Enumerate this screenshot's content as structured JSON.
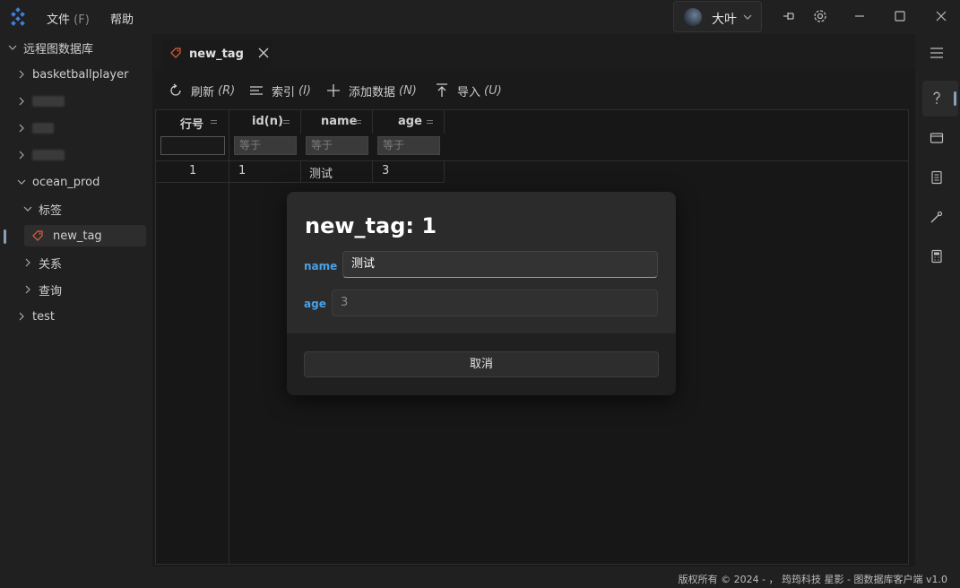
{
  "titlebar": {
    "menu_file": "文件",
    "menu_file_hotkey": "(F)",
    "menu_help": "帮助",
    "user_name": "大叶"
  },
  "sidebar": {
    "root": "远程图数据库",
    "items": [
      {
        "label": "basketballplayer"
      },
      {
        "label": "ocean_prod"
      },
      {
        "label": "标签"
      },
      {
        "label": "new_tag"
      },
      {
        "label": "关系"
      },
      {
        "label": "查询"
      },
      {
        "label": "test"
      }
    ]
  },
  "tab": {
    "label": "new_tag"
  },
  "toolbar": {
    "refresh": "刷新",
    "refresh_key": "(R)",
    "index": "索引",
    "index_key": "(I)",
    "add": "添加数据",
    "add_key": "(N)",
    "import": "导入",
    "import_key": "(U)"
  },
  "grid": {
    "columns": [
      "行号",
      "id(n)",
      "name",
      "age"
    ],
    "filter_placeholder": "等于",
    "rows": [
      [
        "1",
        "1",
        "测试",
        "3"
      ]
    ]
  },
  "modal": {
    "title": "new_tag: 1",
    "fields": [
      {
        "label": "name",
        "value": "测试"
      },
      {
        "label": "age",
        "value": "3"
      }
    ],
    "cancel": "取消"
  },
  "footer": {
    "text": "版权所有 © 2024 - ， 筠筠科技  星影 - 图数据库客户端  v1.0"
  },
  "colors": {
    "accent": "#4aa0e6",
    "background": "#1a1a1a",
    "tag_icon": "#e0603a"
  }
}
